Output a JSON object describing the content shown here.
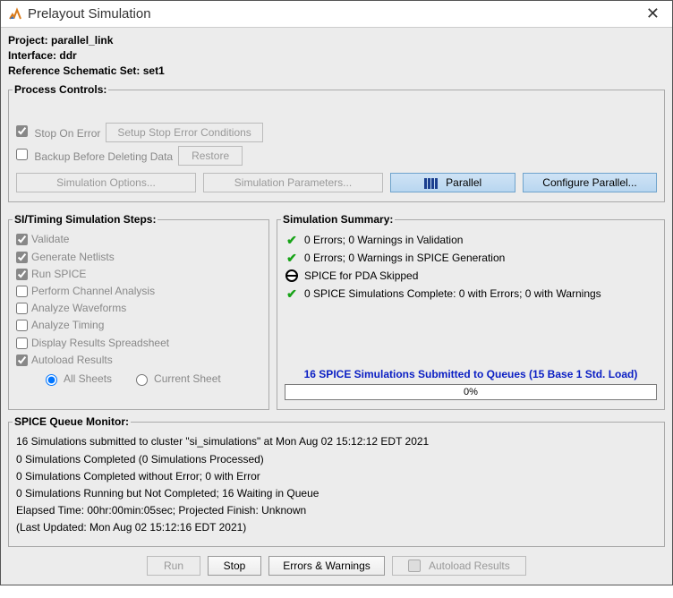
{
  "window": {
    "title": "Prelayout Simulation"
  },
  "header": {
    "project_label": "Project:",
    "project_value": "parallel_link",
    "interface_label": "Interface:",
    "interface_value": "ddr",
    "refset_label": "Reference Schematic Set:",
    "refset_value": "set1"
  },
  "process_controls": {
    "legend": "Process Controls:",
    "stop_on_error": "Stop On Error",
    "setup_stop_error": "Setup Stop Error Conditions",
    "backup_before_delete": "Backup Before Deleting Data",
    "restore": "Restore",
    "simulation_options": "Simulation Options...",
    "simulation_parameters": "Simulation Parameters...",
    "parallel": "Parallel",
    "configure_parallel": "Configure Parallel..."
  },
  "steps": {
    "legend": "SI/Timing Simulation Steps:",
    "validate": "Validate",
    "generate_netlists": "Generate Netlists",
    "run_spice": "Run SPICE",
    "perform_channel_analysis": "Perform Channel Analysis",
    "analyze_waveforms": "Analyze Waveforms",
    "analyze_timing": "Analyze Timing",
    "display_results": "Display Results Spreadsheet",
    "autoload_results": "Autoload Results",
    "all_sheets": "All Sheets",
    "current_sheet": "Current Sheet"
  },
  "summary": {
    "legend": "Simulation Summary:",
    "line1": "0 Errors; 0 Warnings in Validation",
    "line2": "0 Errors; 0 Warnings in SPICE Generation",
    "line3": "SPICE for PDA Skipped",
    "line4": "0 SPICE Simulations Complete: 0 with Errors; 0 with Warnings",
    "submit_note": "16 SPICE Simulations Submitted to Queues (15 Base 1 Std. Load)",
    "progress": "0%"
  },
  "queue": {
    "legend": "SPICE Queue Monitor:",
    "line1": "16 Simulations submitted to cluster \"si_simulations\" at Mon Aug 02 15:12:12 EDT 2021",
    "line2": "0 Simulations Completed (0 Simulations Processed)",
    "line3": "0 Simulations Completed without Error; 0 with Error",
    "line4": "0 Simulations Running but Not Completed; 16 Waiting in Queue",
    "line5": "Elapsed Time: 00hr:00min:05sec; Projected Finish: Unknown",
    "line6": "(Last Updated: Mon Aug 02 15:12:16 EDT 2021)"
  },
  "footer": {
    "run": "Run",
    "stop": "Stop",
    "errors_warnings": "Errors & Warnings",
    "autoload_results": "Autoload Results"
  }
}
